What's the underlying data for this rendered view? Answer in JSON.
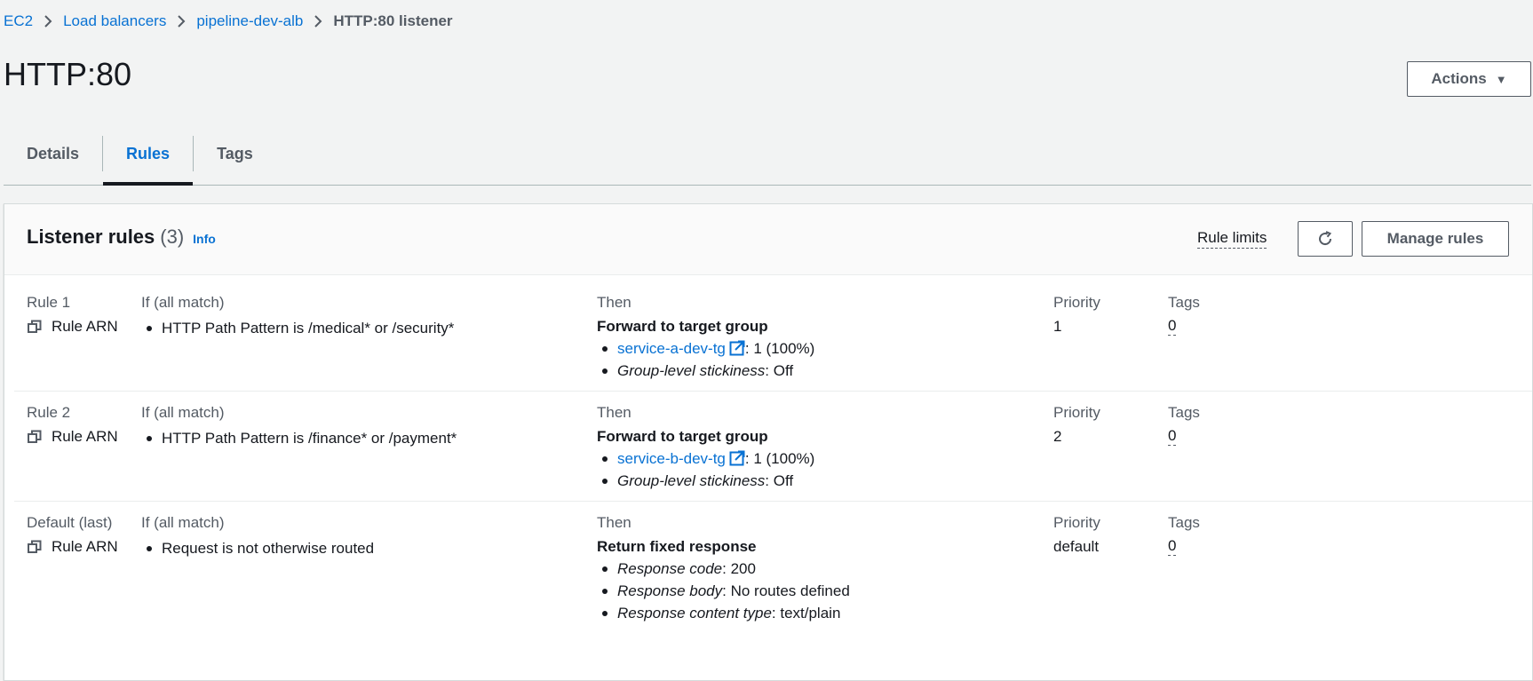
{
  "breadcrumb": {
    "items": [
      "EC2",
      "Load balancers",
      "pipeline-dev-alb"
    ],
    "current": "HTTP:80 listener"
  },
  "page": {
    "title": "HTTP:80",
    "actions_label": "Actions"
  },
  "tabs": [
    {
      "label": "Details",
      "active": false
    },
    {
      "label": "Rules",
      "active": true
    },
    {
      "label": "Tags",
      "active": false
    }
  ],
  "panel": {
    "title": "Listener rules",
    "count": "(3)",
    "info": "Info",
    "rule_limits": "Rule limits",
    "manage_rules": "Manage rules"
  },
  "columns": {
    "condition": "If (all match)",
    "then": "Then",
    "priority": "Priority",
    "tags": "Tags",
    "arn": "Rule ARN"
  },
  "rules": [
    {
      "name": "Rule 1",
      "condition": "HTTP Path Pattern is /medical* or /security*",
      "action": "Forward to target group",
      "target_group": "service-a-dev-tg",
      "weight": ": 1 (100%)",
      "stickiness_label": "Group-level stickiness",
      "stickiness_value": ": Off",
      "priority": "1",
      "tags": "0"
    },
    {
      "name": "Rule 2",
      "condition": "HTTP Path Pattern is /finance* or /payment*",
      "action": "Forward to target group",
      "target_group": "service-b-dev-tg",
      "weight": ": 1 (100%)",
      "stickiness_label": "Group-level stickiness",
      "stickiness_value": ": Off",
      "priority": "2",
      "tags": "0"
    },
    {
      "name": "Default (last)",
      "condition": "Request is not otherwise routed",
      "action": "Return fixed response",
      "response_code_label": "Response code",
      "response_code": ": 200",
      "response_body_label": "Response body",
      "response_body": ": No routes defined",
      "content_type_label": "Response content type",
      "content_type": ": text/plain",
      "priority": "default",
      "tags": "0"
    }
  ],
  "colors": {
    "link": "#0972d3",
    "text": "#16191f",
    "muted": "#545b64",
    "background": "#f2f3f3"
  }
}
